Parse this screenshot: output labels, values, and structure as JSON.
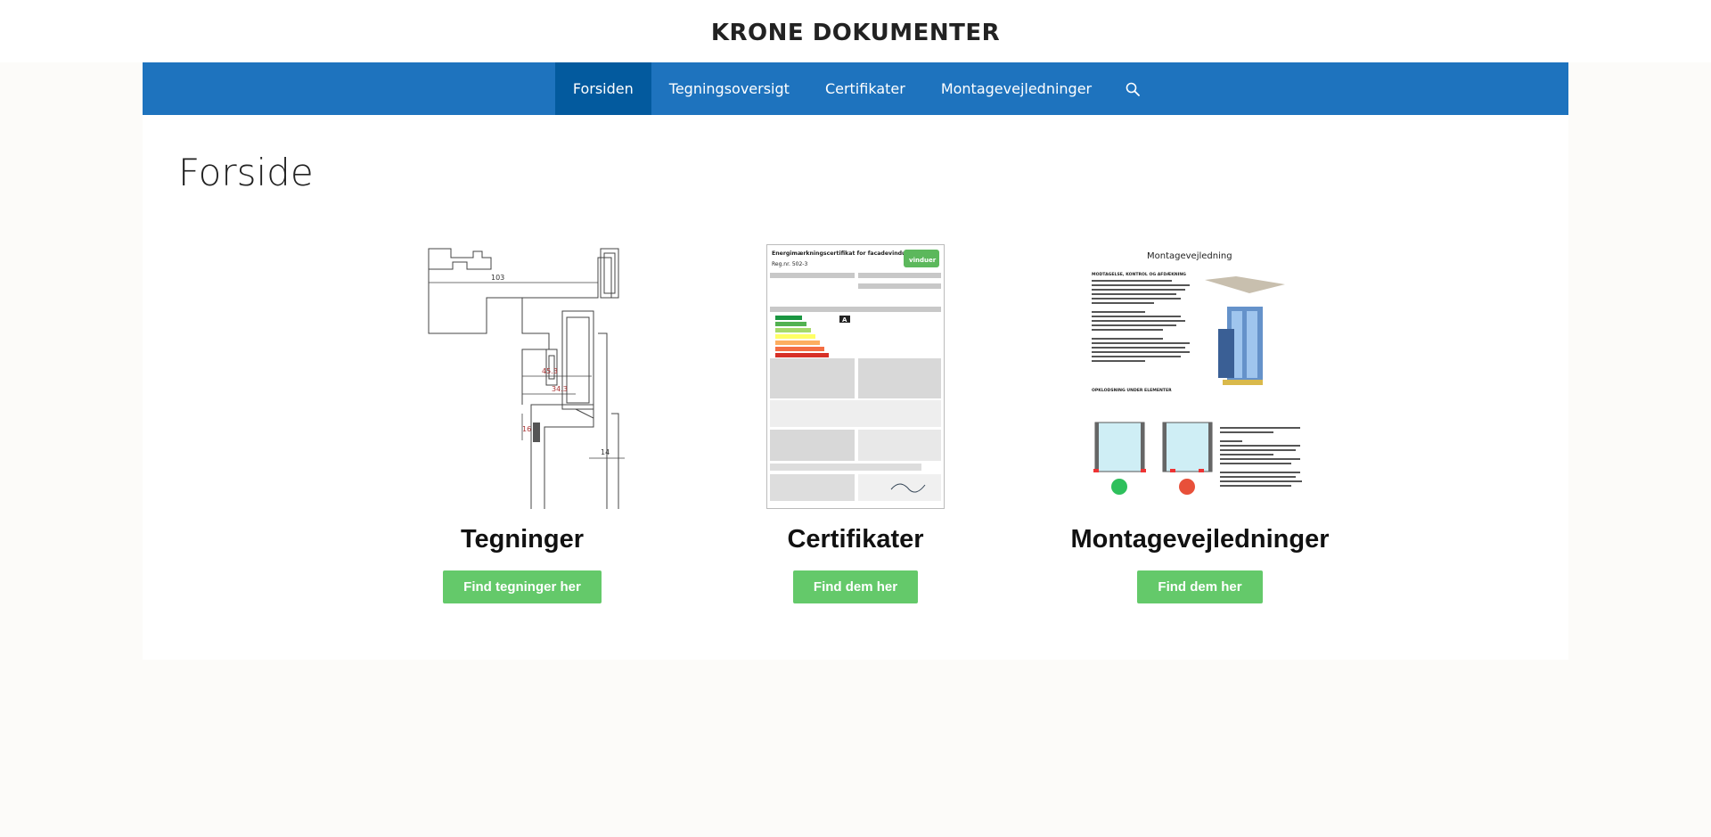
{
  "site": {
    "title": "KRONE DOKUMENTER"
  },
  "nav": {
    "items": [
      {
        "label": "Forsiden",
        "active": true
      },
      {
        "label": "Tegningsoversigt",
        "active": false
      },
      {
        "label": "Certifikater",
        "active": false
      },
      {
        "label": "Montagevejledninger",
        "active": false
      }
    ],
    "search_icon": "search-icon",
    "color": "#1e73be",
    "active_color": "#035a9e"
  },
  "page": {
    "title": "Forside"
  },
  "cards": [
    {
      "heading": "Tegninger",
      "button": "Find tegninger her",
      "drawing": {
        "dim1": "103",
        "dim2": "45.3",
        "dim3": "34.3",
        "dim4": "16",
        "dim5": "14"
      }
    },
    {
      "heading": "Certifikater",
      "button": "Find dem her",
      "doc": {
        "title": "Energimærkningscertifikat for facadevinduer",
        "reg": "Reg.nr. 502-3",
        "badge": "vinduer",
        "rating": "A"
      }
    },
    {
      "heading": "Montagevejledninger",
      "button": "Find dem her",
      "doc": {
        "title": "Montagevejledning",
        "section1": "MODTAGELSE, KONTROL OG AFDÆKNING",
        "section2": "OPKLODSNING UNDER ELEMENTER"
      }
    }
  ],
  "button_color": "#64c96a"
}
